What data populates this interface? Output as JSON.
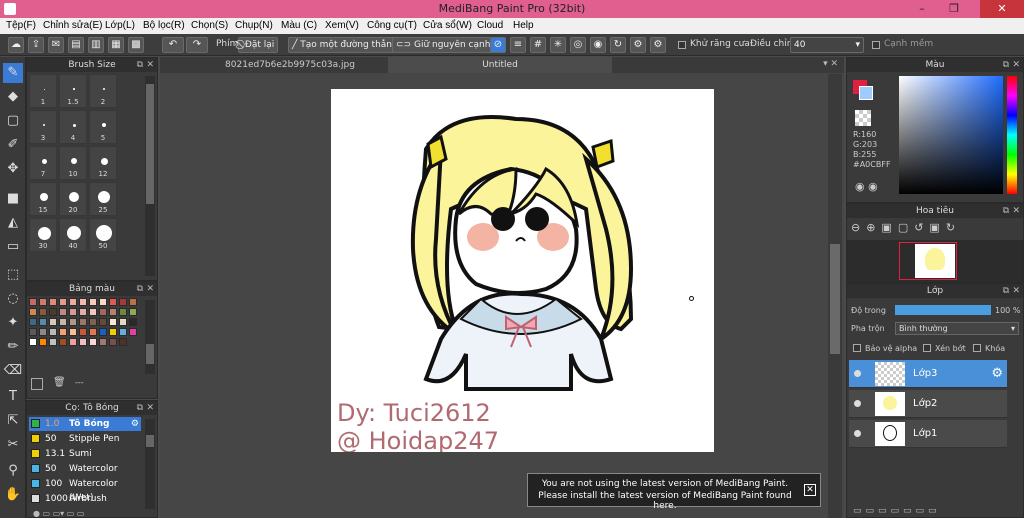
{
  "window": {
    "title": "MediBang Paint Pro (32bit)",
    "min": "–",
    "restore": "❐",
    "close": "✕"
  },
  "menu": [
    "Tệp(F)",
    "Chỉnh sửa(E)",
    "Lớp(L)",
    "Bộ lọc(R)",
    "Chọn(S)",
    "Chụp(N)",
    "Màu (C)",
    "Xem(V)",
    "Công cụ(T)",
    "Cửa sổ(W)",
    "Cloud",
    "Help"
  ],
  "toolbar": {
    "phim": "Phím",
    "reset": "Đặt lại",
    "make_line": "Tạo một đường thẳng",
    "keep_edge": "Giữ nguyên cạnh",
    "antialias": "Khử răng cưa",
    "adjust_label": "Điều chỉnh",
    "adjust_value": "40",
    "smooth": "Cạnh mềm"
  },
  "brush_size": {
    "title": "Brush Size",
    "labels": [
      "1",
      "1.5",
      "2",
      "3",
      "4",
      "5",
      "7",
      "10",
      "12",
      "15",
      "20",
      "25",
      "30",
      "40",
      "50"
    ]
  },
  "palette": {
    "title": "Bảng màu",
    "footer": "---"
  },
  "brush_list": {
    "title": "Cọ: Tô Bóng",
    "items": [
      {
        "size": "1.0",
        "name": "Tô Bóng",
        "color": "#2db34a",
        "selected": true
      },
      {
        "size": "50",
        "name": "Stipple Pen",
        "color": "#f0d000"
      },
      {
        "size": "13.1",
        "name": "Sumi",
        "color": "#f0d000"
      },
      {
        "size": "50",
        "name": "Watercolor",
        "color": "#4ab4e6"
      },
      {
        "size": "100",
        "name": "Watercolor (Wet)",
        "color": "#4ab4e6"
      },
      {
        "size": "1000",
        "name": "Airbrush",
        "color": "#dddddd"
      }
    ]
  },
  "doc_tabs": [
    "8021ed7b6e2b9975c03a.jpg",
    "Untitled"
  ],
  "canvas_text": {
    "line1": "Dy: Tuci2612",
    "line2": "@ Hoidap247"
  },
  "notice": {
    "line1": "You are not using the latest version of MediBang Paint.",
    "line2": "Please install the latest version of MediBang Paint found here.",
    "close": "✕"
  },
  "color_panel": {
    "title": "Màu",
    "r": "R:160",
    "g": "G:203",
    "b": "B:255",
    "hex": "#A0CBFF",
    "color": "#A0CBFF"
  },
  "navigator": {
    "title": "Hoa tiêu"
  },
  "layer_panel": {
    "title": "Lớp",
    "opacity_label": "Độ trong",
    "opacity_value": "100 %",
    "blend_label": "Pha trộn",
    "blend_value": "Bình thường",
    "protect_alpha": "Bảo vệ alpha",
    "clip": "Xén bớt",
    "lock": "Khóa",
    "layers": [
      "Lớp3",
      "Lớp2",
      "Lớp1"
    ]
  }
}
